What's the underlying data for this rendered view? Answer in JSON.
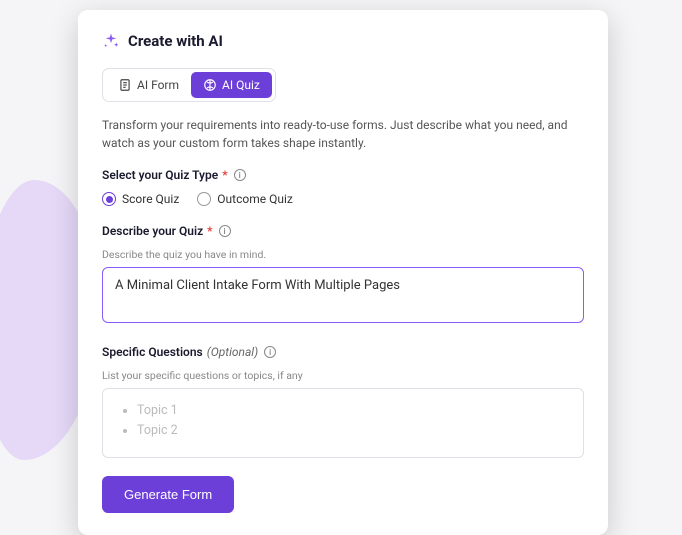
{
  "header": {
    "title": "Create with AI"
  },
  "tabs": {
    "form": "AI Form",
    "quiz": "AI Quiz"
  },
  "description": "Transform your requirements into ready-to-use forms. Just describe what you need, and watch as your custom form takes shape instantly.",
  "quizType": {
    "label": "Select your Quiz Type",
    "score": "Score Quiz",
    "outcome": "Outcome Quiz"
  },
  "describe": {
    "label": "Describe your Quiz",
    "helper": "Describe the quiz you have in mind.",
    "value": "A Minimal Client Intake Form With Multiple Pages"
  },
  "specific": {
    "label": "Specific Questions",
    "optional": "(Optional)",
    "helper": "List your specific questions or topics, if any",
    "topic1": "Topic 1",
    "topic2": "Topic 2"
  },
  "button": {
    "generate": "Generate Form"
  }
}
